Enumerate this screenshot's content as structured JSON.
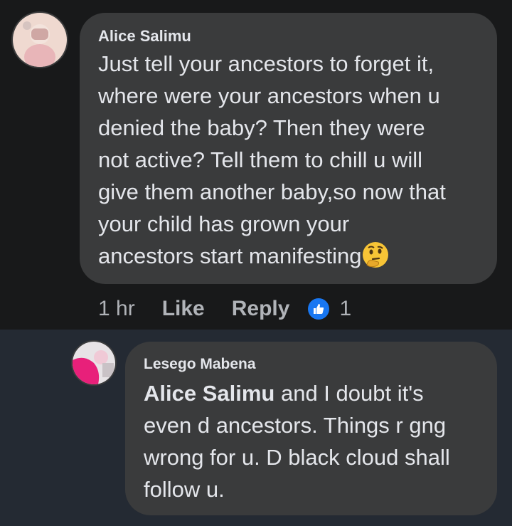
{
  "comments": {
    "main": {
      "author": "Alice Salimu",
      "text": "Just tell your ancestors to forget it,\nwhere were your ancestors when u\ndenied the baby? Then they were\nnot active? Tell them to chill u will\ngive them another baby,so now that\nyour child has grown your\nancestors start manifesting",
      "emoji": "thinking-face-emoji",
      "time": "1 hr",
      "like_label": "Like",
      "reply_label": "Reply",
      "reaction_icon": "thumbs-up-icon",
      "reaction_count": "1"
    },
    "reply": {
      "author": "Lesego Mabena",
      "mention": "Alice Salimu",
      "text": " and I doubt it's\neven d ancestors. Things r gng\nwrong for u. D black cloud shall\nfollow u."
    }
  },
  "colors": {
    "background_top": "#18191a",
    "background_bottom": "#242a33",
    "bubble": "#3a3b3c",
    "text": "#e4e6eb",
    "secondary_text": "#b0b3b8",
    "like_blue": "#1877f2"
  }
}
